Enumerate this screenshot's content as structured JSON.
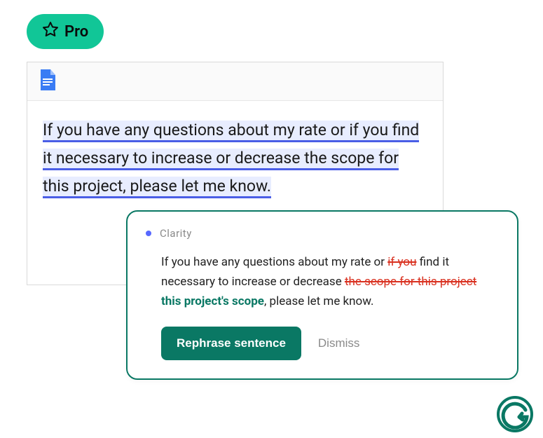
{
  "pro_badge": {
    "label": "Pro"
  },
  "document": {
    "sentence": "If you have any questions about my rate or if you find it necessary to increase or decrease the scope for this project, please let me know."
  },
  "suggestion": {
    "category": "Clarity",
    "segments": {
      "p1": "If you have any questions about my rate or ",
      "s1": "if you",
      "p2": " find it necessary to increase or decrease ",
      "s2": "the scope for this project",
      "ins1": " this project's scope",
      "p3": ", please let me know."
    },
    "actions": {
      "rephrase": "Rephrase sentence",
      "dismiss": "Dismiss"
    }
  },
  "colors": {
    "badge_bg": "#11c697",
    "highlight_bg": "#e8edff",
    "highlight_underline": "#4a5ee6",
    "popup_border": "#0a7864",
    "strike": "#d9301f",
    "insert": "#0a7864"
  }
}
